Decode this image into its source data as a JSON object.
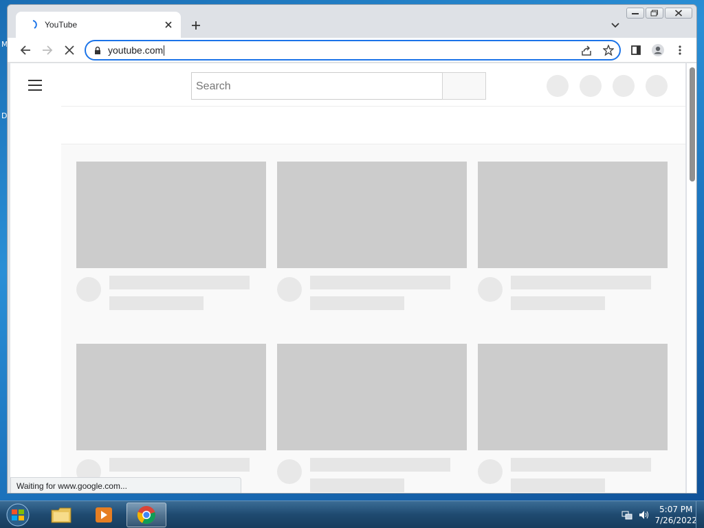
{
  "desktop": {
    "fragment_top": "M",
    "fragment_mid": "D"
  },
  "browser": {
    "tab": {
      "title": "YouTube"
    },
    "address_bar": {
      "url": "youtube.com"
    },
    "status_bubble": "Waiting for www.google.com..."
  },
  "page": {
    "search": {
      "placeholder": "Search"
    }
  },
  "taskbar": {
    "clock": {
      "time": "5:07 PM",
      "date": "7/26/2022"
    }
  },
  "colors": {
    "accent": "#1a73e8",
    "skeleton_thumb": "#cccccc",
    "skeleton_line": "#e6e6e6"
  },
  "icons": [
    "spinner-icon",
    "close-icon",
    "plus-icon",
    "chevron-down-icon",
    "back-arrow-icon",
    "forward-arrow-icon",
    "stop-loading-icon",
    "lock-icon",
    "share-icon",
    "star-icon",
    "side-panel-icon",
    "profile-icon",
    "kebab-menu-icon",
    "hamburger-icon",
    "windows-start-icon",
    "file-explorer-icon",
    "media-player-icon",
    "chrome-icon",
    "network-icon",
    "volume-icon"
  ]
}
